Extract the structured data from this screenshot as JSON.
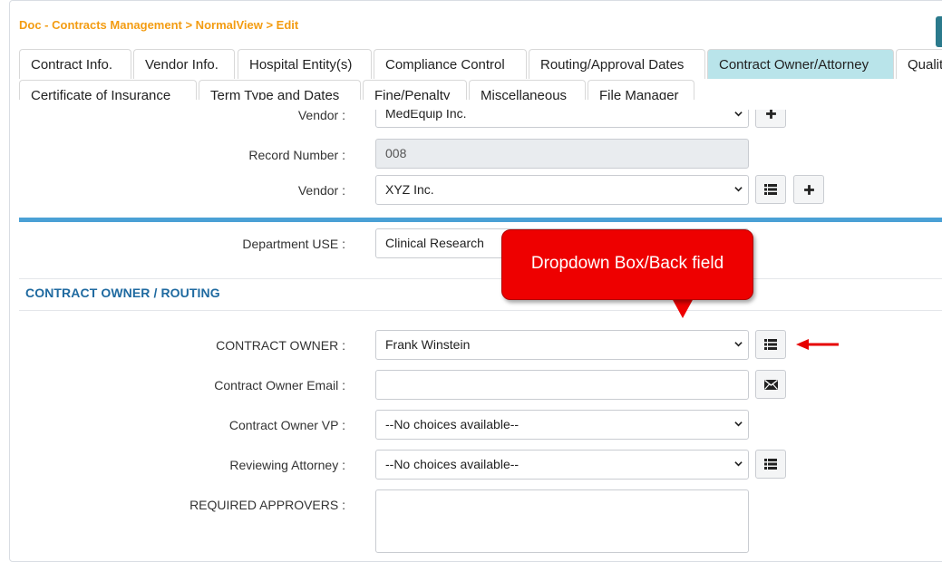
{
  "breadcrumb": "Doc - Contracts Management > NormalView > Edit",
  "tabs_row1": [
    {
      "label": "Contract Info."
    },
    {
      "label": "Vendor Info."
    },
    {
      "label": "Hospital Entity(s)"
    },
    {
      "label": "Compliance Control"
    },
    {
      "label": "Routing/Approval Dates"
    },
    {
      "label": "Contract Owner/Attorney"
    },
    {
      "label": "Quality"
    }
  ],
  "tabs_row2": [
    {
      "label": "Certificate of Insurance"
    },
    {
      "label": "Term Type and Dates"
    },
    {
      "label": "Fine/Penalty"
    },
    {
      "label": "Miscellaneous"
    },
    {
      "label": "File Manager"
    }
  ],
  "active_tab": "Contract Owner/Attorney",
  "form": {
    "vendor_top": {
      "label": "Vendor :",
      "value": "MedEquip Inc."
    },
    "record_number": {
      "label": "Record Number :",
      "value": "008"
    },
    "vendor": {
      "label": "Vendor :",
      "value": "XYZ Inc."
    },
    "department_use": {
      "label": "Department USE :",
      "value": "Clinical Research"
    },
    "section_title": "CONTRACT OWNER / ROUTING",
    "contract_owner": {
      "label": "CONTRACT OWNER :",
      "value": "Frank Winstein"
    },
    "contract_owner_email": {
      "label": "Contract Owner Email :",
      "value": ""
    },
    "contract_owner_vp": {
      "label": "Contract Owner VP :",
      "value": "--No choices available--"
    },
    "reviewing_attorney": {
      "label": "Reviewing Attorney :",
      "value": "--No choices available--"
    },
    "required_approvers": {
      "label": "REQUIRED APPROVERS :",
      "value": ""
    }
  },
  "callout": {
    "text": "Dropdown Box/Back field"
  },
  "icons": {
    "list": "list-icon",
    "plus": "plus-icon",
    "envelope": "envelope-icon",
    "chevron": "chevron-down-icon",
    "arrow": "arrow-left-icon"
  },
  "colors": {
    "breadcrumb": "#f39c12",
    "active_tab": "#b9e4ea",
    "section_title": "#1f6aa0",
    "divider": "#4aa0d5",
    "callout": "#ee0000"
  }
}
